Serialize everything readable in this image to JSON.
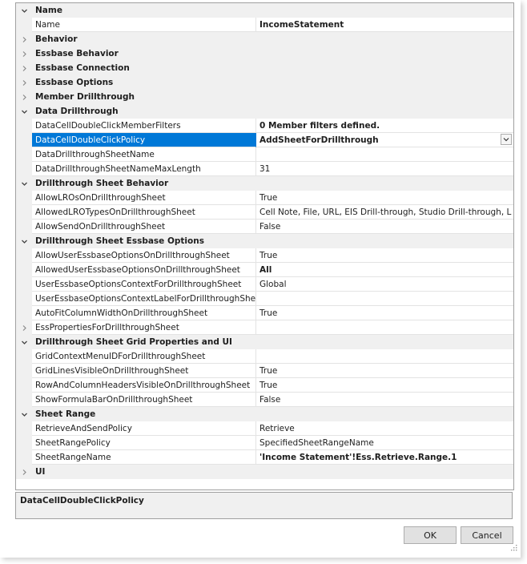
{
  "rows": [
    {
      "kind": "cat",
      "expanded": true,
      "label": "Name"
    },
    {
      "kind": "prop",
      "name": "Name",
      "value": "IncomeStatement",
      "bold": true
    },
    {
      "kind": "cat",
      "expanded": false,
      "label": "Behavior"
    },
    {
      "kind": "cat",
      "expanded": false,
      "label": "Essbase Behavior"
    },
    {
      "kind": "cat",
      "expanded": false,
      "label": "Essbase Connection"
    },
    {
      "kind": "cat",
      "expanded": false,
      "label": "Essbase Options"
    },
    {
      "kind": "cat",
      "expanded": false,
      "label": "Member Drillthrough"
    },
    {
      "kind": "cat",
      "expanded": true,
      "label": "Data Drillthrough"
    },
    {
      "kind": "prop",
      "name": "DataCellDoubleClickMemberFilters",
      "value": "0 Member filters defined.",
      "bold": true
    },
    {
      "kind": "prop",
      "name": "DataCellDoubleClickPolicy",
      "value": "AddSheetForDrillthrough",
      "bold": true,
      "selected": true,
      "dropdown": true
    },
    {
      "kind": "prop",
      "name": "DataDrillthroughSheetName",
      "value": ""
    },
    {
      "kind": "prop",
      "name": "DataDrillthroughSheetNameMaxLength",
      "value": "31"
    },
    {
      "kind": "cat",
      "expanded": true,
      "label": "Drillthrough Sheet Behavior"
    },
    {
      "kind": "prop",
      "name": "AllowLROsOnDrillthroughSheet",
      "value": "True"
    },
    {
      "kind": "prop",
      "name": "AllowedLROTypesOnDrillthroughSheet",
      "value": "Cell Note, File, URL, EIS Drill-through, Studio Drill-through, L"
    },
    {
      "kind": "prop",
      "name": "AllowSendOnDrillthroughSheet",
      "value": "False"
    },
    {
      "kind": "cat",
      "expanded": true,
      "label": "Drillthrough Sheet Essbase Options"
    },
    {
      "kind": "prop",
      "name": "AllowUserEssbaseOptionsOnDrillthroughSheet",
      "value": "True"
    },
    {
      "kind": "prop",
      "name": "AllowedUserEssbaseOptionsOnDrillthroughSheet",
      "value": "All",
      "bold": true
    },
    {
      "kind": "prop",
      "name": "UserEssbaseOptionsContextForDrillthroughSheet",
      "value": "Global"
    },
    {
      "kind": "prop",
      "name": "UserEssbaseOptionsContextLabelForDrillthroughSheet",
      "value": ""
    },
    {
      "kind": "prop",
      "name": "AutoFitColumnWidthOnDrillthroughSheet",
      "value": "True"
    },
    {
      "kind": "prop",
      "name": "EssPropertiesForDrillthroughSheet",
      "value": "",
      "expandable": true
    },
    {
      "kind": "cat",
      "expanded": true,
      "label": "Drillthrough Sheet Grid Properties and UI"
    },
    {
      "kind": "prop",
      "name": "GridContextMenuIDForDrillthroughSheet",
      "value": ""
    },
    {
      "kind": "prop",
      "name": "GridLinesVisibleOnDrillthroughSheet",
      "value": "True"
    },
    {
      "kind": "prop",
      "name": "RowAndColumnHeadersVisibleOnDrillthroughSheet",
      "value": "True"
    },
    {
      "kind": "prop",
      "name": "ShowFormulaBarOnDrillthroughSheet",
      "value": "False"
    },
    {
      "kind": "cat",
      "expanded": true,
      "label": "Sheet Range"
    },
    {
      "kind": "prop",
      "name": "RetrieveAndSendPolicy",
      "value": "Retrieve"
    },
    {
      "kind": "prop",
      "name": "SheetRangePolicy",
      "value": "SpecifiedSheetRangeName"
    },
    {
      "kind": "prop",
      "name": "SheetRangeName",
      "value": "'Income Statement'!Ess.Retrieve.Range.1",
      "bold": true
    },
    {
      "kind": "cat",
      "expanded": false,
      "label": "UI"
    }
  ],
  "description": {
    "title": "DataCellDoubleClickPolicy"
  },
  "buttons": {
    "ok": "OK",
    "cancel": "Cancel"
  },
  "colors": {
    "selection": "#0078d7",
    "category_bg": "#f0f0f0",
    "grid_line": "#e3e3e3"
  }
}
